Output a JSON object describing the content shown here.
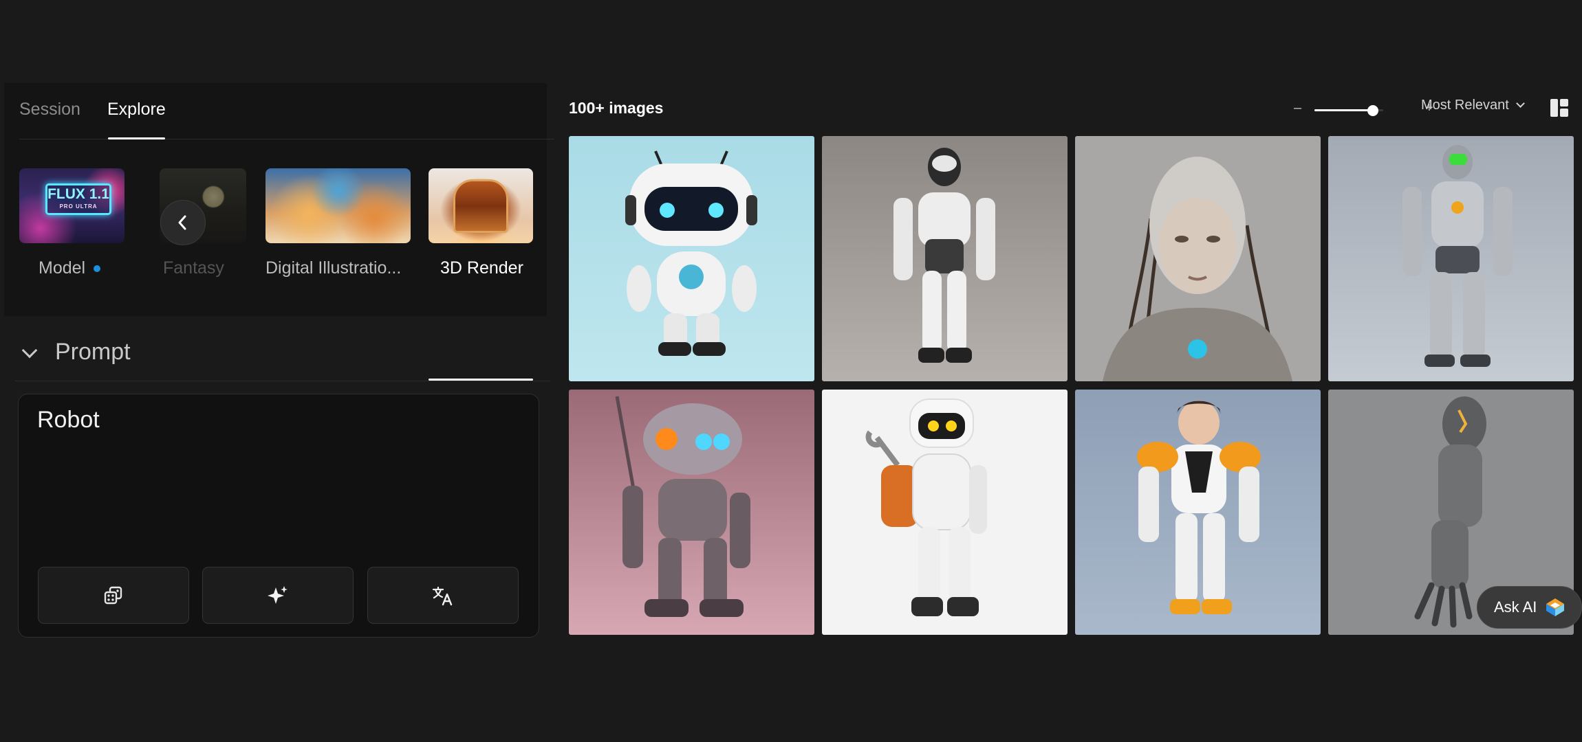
{
  "left_panel": {
    "tabs": [
      {
        "label": "Session",
        "active": false
      },
      {
        "label": "Explore",
        "active": true
      }
    ],
    "styles": [
      {
        "label": "Model",
        "badge": "blue-dot",
        "thumb_text": "FLUX 1.1",
        "thumb_subtext": "PRO ULTRA"
      },
      {
        "label": "Fantasy"
      },
      {
        "label": "Digital Illustratio..."
      },
      {
        "label": "3D Render",
        "selected": true
      }
    ],
    "prompt": {
      "title": "Prompt",
      "value": "Robot",
      "tools": [
        {
          "icon": "dice-icon"
        },
        {
          "icon": "sparkle-icon"
        },
        {
          "icon": "translate-icon"
        }
      ]
    }
  },
  "gallery": {
    "count_label": "100+ images",
    "zoom": {
      "minus": "–",
      "plus": "+",
      "level": 0.85
    },
    "sort_label": "Most Relevant",
    "layout_icon": "masonry-layout-icon",
    "images": [
      {
        "subject": "cute white robot with antennas"
      },
      {
        "subject": "white humanoid robot standing"
      },
      {
        "subject": "cyborg woman with cables"
      },
      {
        "subject": "silver robot with green visor"
      },
      {
        "subject": "pink retro robot with antenna"
      },
      {
        "subject": "robot with wrench and backpack"
      },
      {
        "subject": "boy in orange mech suit"
      },
      {
        "subject": "robotic arm"
      }
    ]
  },
  "ask_ai": {
    "label": "Ask AI"
  },
  "colors": {
    "accent_blue": "#1d8fe0",
    "background": "#1a1a1a",
    "panel": "#141414"
  }
}
